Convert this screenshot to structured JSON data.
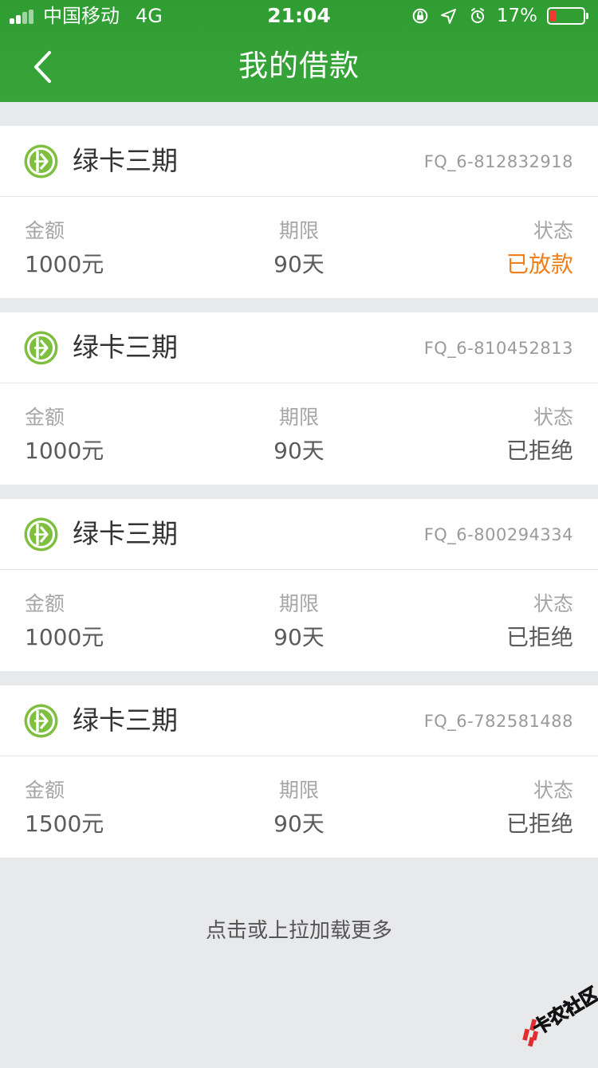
{
  "status_bar": {
    "carrier": "中国移动",
    "network": "4G",
    "time": "21:04",
    "battery_percent": "17%",
    "battery_level": 0.17
  },
  "header": {
    "title": "我的借款",
    "back_icon": "chevron-left-icon"
  },
  "theme": {
    "header_green": "#37a53a",
    "logo_green": "#7fbf3f",
    "status_orange": "#ef7f1a",
    "page_bg": "#e8e9eb"
  },
  "loans": [
    {
      "product": "绿卡三期",
      "order_no": "FQ_6-812832918",
      "amount_label": "金额",
      "amount": "1000元",
      "term_label": "期限",
      "term": "90天",
      "status_label": "状态",
      "status": "已放款"
    },
    {
      "product": "绿卡三期",
      "order_no": "FQ_6-810452813",
      "amount_label": "金额",
      "amount": "1000元",
      "term_label": "期限",
      "term": "90天",
      "status_label": "状态",
      "status": "已拒绝"
    },
    {
      "product": "绿卡三期",
      "order_no": "FQ_6-800294334",
      "amount_label": "金额",
      "amount": "1000元",
      "term_label": "期限",
      "term": "90天",
      "status_label": "状态",
      "status": "已拒绝"
    },
    {
      "product": "绿卡三期",
      "order_no": "FQ_6-782581488",
      "amount_label": "金额",
      "amount": "1500元",
      "term_label": "期限",
      "term": "90天",
      "status_label": "状态",
      "status": "已拒绝"
    }
  ],
  "footer": {
    "load_more": "点击或上拉加载更多"
  },
  "watermark": {
    "text": "卡农社区"
  }
}
